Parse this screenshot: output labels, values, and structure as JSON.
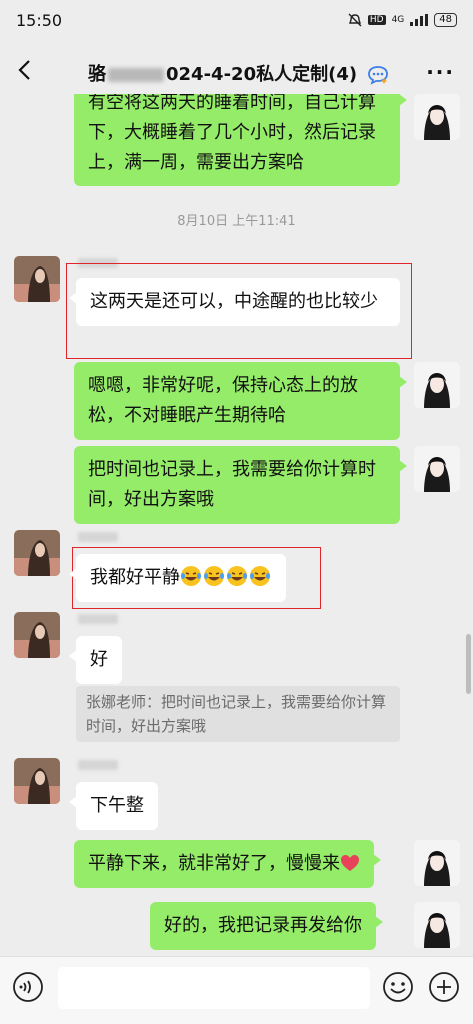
{
  "status": {
    "time": "15:50",
    "hd": "HD",
    "network": "4G",
    "battery": "48"
  },
  "header": {
    "title_prefix": "骆",
    "title_suffix": "024-4-20私人定制(4)"
  },
  "messages": {
    "m1": "有空将这两天的睡着时间，自己计算下，大概睡着了几个小时，然后记录上，满一周，需要出方案哈",
    "ts": "8月10日 上午11:41",
    "m2": "这两天是还可以，中途醒的也比较少",
    "m3": "嗯嗯，非常好呢，保持心态上的放松，不对睡眠产生期待哈",
    "m4": "把时间也记录上，我需要给你计算时间，好出方案哦",
    "m5": "我都好平静",
    "m6": "好",
    "m6_quote": "张娜老师：把时间也记录上，我需要给你计算时间，好出方案哦",
    "m7": "下午整",
    "m8": "平静下来，就非常好了，慢慢来",
    "m9": "好的，我把记录再发给你"
  },
  "icons": {
    "back": "back-arrow-icon",
    "more": "more-icon",
    "voice": "voice-icon",
    "emoji": "emoji-icon",
    "plus": "plus-icon"
  },
  "colors": {
    "my_bubble": "#95ec69",
    "other_bubble": "#ffffff",
    "highlight": "#e0242b"
  }
}
